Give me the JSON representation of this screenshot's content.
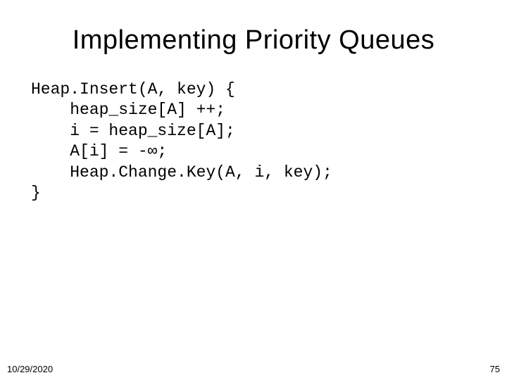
{
  "title": "Implementing Priority Queues",
  "code": {
    "line1": "Heap.Insert(A, key) {",
    "line2": "    heap_size[A] ++;",
    "line3": "    i = heap_size[A];",
    "line4": "    A[i] = -∞;",
    "line5": "    Heap.Change.Key(A, i, key);",
    "line6": "}"
  },
  "footer": {
    "date": "10/29/2020",
    "page": "75"
  }
}
